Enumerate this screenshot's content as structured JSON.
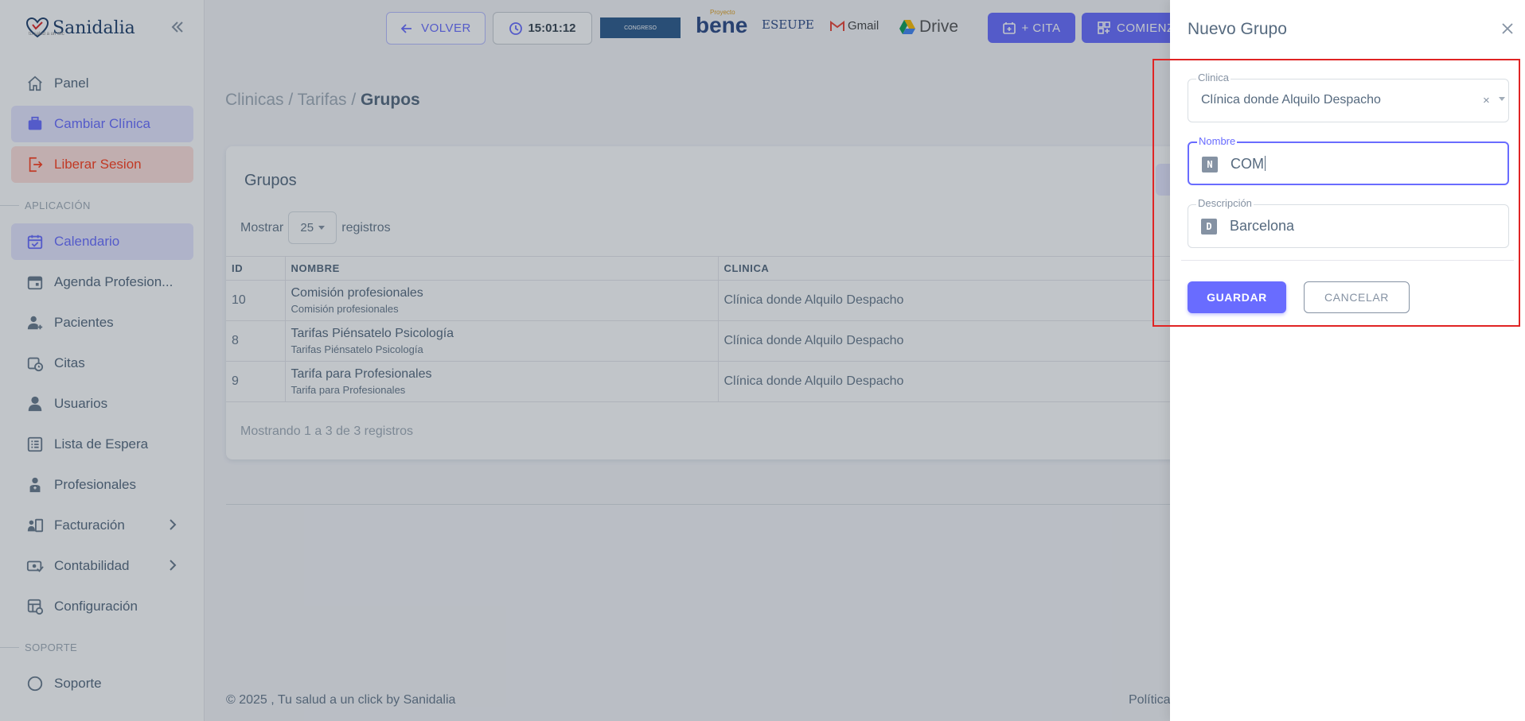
{
  "brand": {
    "name": "Sanidalia",
    "tagline": "tu salud a un clic"
  },
  "sidebar": {
    "items": [
      {
        "label": "Panel",
        "icon": "home-icon"
      },
      {
        "label": "Cambiar Clínica",
        "icon": "briefcase-icon"
      },
      {
        "label": "Liberar Sesion",
        "icon": "logout-icon"
      }
    ],
    "section_app": "APLICACIÓN",
    "app_items": [
      {
        "label": "Calendario",
        "icon": "calendar-check-icon"
      },
      {
        "label": "Agenda Profesion...",
        "icon": "calendar-icon"
      },
      {
        "label": "Pacientes",
        "icon": "user-plus-icon"
      },
      {
        "label": "Citas",
        "icon": "calendar-clock-icon"
      },
      {
        "label": "Usuarios",
        "icon": "user-icon"
      },
      {
        "label": "Lista de Espera",
        "icon": "list-icon"
      },
      {
        "label": "Profesionales",
        "icon": "doctor-icon"
      },
      {
        "label": "Facturación",
        "icon": "billing-icon"
      },
      {
        "label": "Contabilidad",
        "icon": "money-icon"
      },
      {
        "label": "Configuración",
        "icon": "settings-icon"
      }
    ],
    "section_support": "SOPORTE",
    "support_items": [
      {
        "label": "Soporte",
        "icon": "support-icon"
      }
    ]
  },
  "topbar": {
    "volver": "VOLVER",
    "clock": "15:01:12",
    "congreso": "CONGRESO",
    "bene_small": "Proyecto",
    "bene": "bene",
    "eseupe": "ESEUPE",
    "gmail": "Gmail",
    "drive": "Drive",
    "cita": "+ CITA",
    "comienza": "COMIENZA"
  },
  "breadcrumb": {
    "part1": "Clinicas",
    "sep": " / ",
    "part2": "Tarifas",
    "current": "Grupos"
  },
  "card": {
    "title": "Grupos",
    "show_label": "Mostrar",
    "show_value": "25",
    "show_suffix": "registros",
    "columns": [
      "ID",
      "NOMBRE",
      "CLINICA"
    ],
    "rows": [
      {
        "id": "10",
        "name": "Comisión profesionales",
        "desc": "Comisión profesionales",
        "clinic": "Clínica donde Alquilo Despacho"
      },
      {
        "id": "8",
        "name": "Tarifas Piénsatelo Psicología",
        "desc": "Tarifas Piénsatelo Psicología",
        "clinic": "Clínica donde Alquilo Despacho"
      },
      {
        "id": "9",
        "name": "Tarifa para Profesionales",
        "desc": "Tarifa para Profesionales",
        "clinic": "Clínica donde Alquilo Despacho"
      }
    ],
    "info": "Mostrando 1 a 3 de 3 registros"
  },
  "footer": {
    "left": "© 2025 , Tu salud a un click by Sanidalia",
    "right": "Política"
  },
  "panel": {
    "title": "Nuevo Grupo",
    "clinica_label": "Clinica",
    "clinica_value": "Clínica donde Alquilo Despacho",
    "nombre_label": "Nombre",
    "nombre_badge": "N",
    "nombre_value": "COM",
    "desc_label": "Descripción",
    "desc_badge": "D",
    "desc_value": "Barcelona",
    "guardar": "GUARDAR",
    "cancelar": "CANCELAR"
  },
  "colors": {
    "accent": "#696cff",
    "highlight": "#e02424",
    "danger": "#ff3e1d"
  }
}
